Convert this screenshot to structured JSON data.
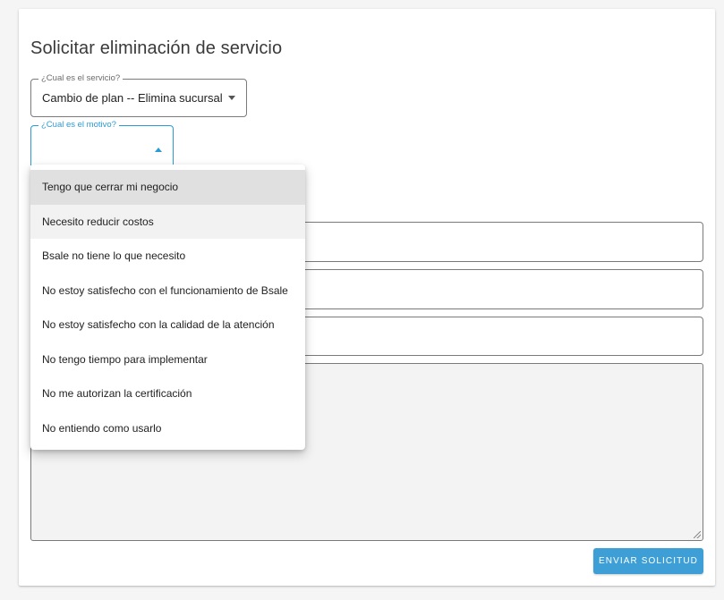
{
  "page": {
    "title": "Solicitar eliminación de servicio"
  },
  "service_select": {
    "label": "¿Cual es el servicio?",
    "value": "Cambio de plan -- Elimina sucursal",
    "icon": "chevron-down-icon"
  },
  "motivo_select": {
    "label": "¿Cual es el motivo?",
    "value": "",
    "expanded": true,
    "icon": "chevron-up-icon",
    "options": [
      "Tengo que cerrar mi negocio",
      "Necesito reducir costos",
      "Bsale no tiene lo que necesito",
      "No estoy satisfecho con el funcionamiento de Bsale",
      "No estoy satisfecho con la calidad de la atención",
      "No tengo tiempo para implementar",
      "No me autorizan la certificación",
      "No entiendo como usarlo"
    ]
  },
  "submit_button": {
    "label": "ENVIAR SOLICITUD"
  },
  "colors": {
    "accent": "#3d9fd6",
    "focus_border": "#2c9bd3",
    "border": "#7a7a7a",
    "background": "#f5f5f5",
    "selected_option": "#e0e0e0",
    "hovered_option": "#f2f2f2"
  }
}
